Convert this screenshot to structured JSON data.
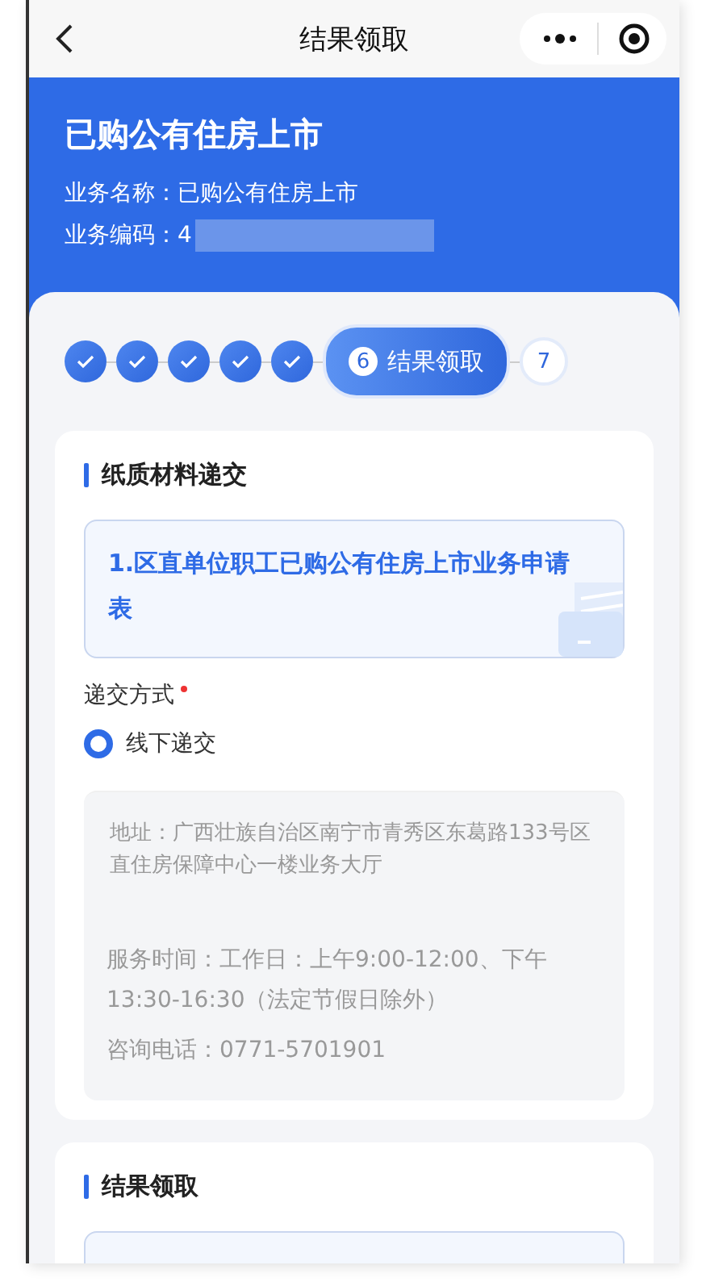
{
  "nav": {
    "title": "结果领取"
  },
  "header": {
    "title": "已购公有住房上市",
    "name_label": "业务名称：",
    "name_value": "已购公有住房上市",
    "code_label": "业务编码：",
    "code_value": "4"
  },
  "steps": [
    {
      "done": true,
      "selected": false
    },
    {
      "done": true,
      "selected": false
    },
    {
      "done": true,
      "selected": false
    },
    {
      "done": true,
      "selected": false
    },
    {
      "done": true,
      "selected": false
    },
    {
      "done": false,
      "selected": true,
      "number": "6",
      "label": "结果领取"
    },
    {
      "done": false,
      "selected": false,
      "number": "7"
    }
  ],
  "paper_section": {
    "title": "纸质材料递交",
    "document": "1.区直单位职工已购公有住房上市业务申请表",
    "method_label": "递交方式",
    "required": true,
    "options": [
      {
        "label": "线下递交",
        "selected": true
      }
    ],
    "info": {
      "address": "地址：广西壮族自治区南宁市青秀区东葛路133号区直住房保障中心一楼业务大厅",
      "hours": "服务时间：工作日：上午9:00-12:00、下午13:30-16:30（法定节假日除外）",
      "phone": "咨询电话：0771-5701901"
    }
  },
  "result_section": {
    "title": "结果领取"
  }
}
